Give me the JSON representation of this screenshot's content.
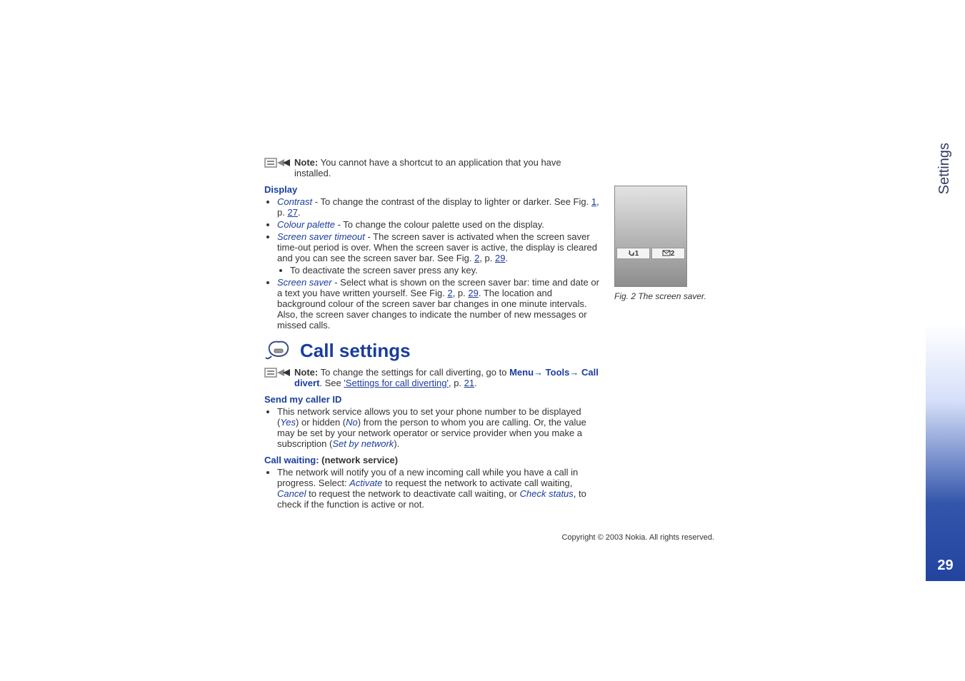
{
  "side_tab": "Settings",
  "page_number": "29",
  "copyright": "Copyright © 2003 Nokia. All rights reserved.",
  "note1": {
    "label": "Note:",
    "text": " You cannot have a shortcut to an application that you have installed."
  },
  "display_heading": "Display",
  "items": {
    "contrast": {
      "link": "Contrast",
      "text1": " - To change the contrast of the display to lighter or darker. See Fig. ",
      "fig": "1",
      "text2": ", p. ",
      "page": "27",
      "text3": "."
    },
    "colour": {
      "link": "Colour palette",
      "text": " - To change the colour palette used on the display."
    },
    "timeout": {
      "link": "Screen saver timeout",
      "text1": " - The screen saver is activated when the screen saver time-out period is over. When the screen saver is active, the display is cleared and you can see the screen saver bar. See Fig. ",
      "fig": "2",
      "text2": ", p. ",
      "page": "29",
      "text3": ".",
      "sub": "To deactivate the screen saver press any key."
    },
    "saver": {
      "link": "Screen saver",
      "text1": " - Select what is shown on the screen saver bar: time and date or a text you have written yourself. See Fig. ",
      "fig": "2",
      "text2": ", p. ",
      "page": "29",
      "text3": ". The location and background colour of the screen saver bar changes in one minute intervals. Also, the screen saver changes to indicate the number of new messages or missed calls."
    }
  },
  "call_settings_heading": "Call settings",
  "note2": {
    "label": "Note:",
    "text1": " To change the settings for call diverting, go to ",
    "menu": "Menu",
    "tools": "Tools",
    "divert": "Call divert",
    "text2": ". See ",
    "ref": "'Settings for call diverting'",
    "text3": ", p. ",
    "page": "21",
    "text4": "."
  },
  "send_heading": "Send my caller ID",
  "send_item": {
    "text1": "This network service allows you to set your phone number to be displayed (",
    "yes": "Yes",
    "text2": ") or hidden (",
    "no": "No",
    "text3": ") from the person to whom you are calling. Or, the value may be set by your network operator or service provider when you make a subscription (",
    "sbn": "Set by network",
    "text4": ")."
  },
  "wait_heading": "Call waiting:",
  "wait_nservice": " (network service)",
  "wait_item": {
    "text1": "The network will notify you of a new incoming call while you have a call in progress. Select: ",
    "activate": "Activate",
    "text2": " to request the network to activate call waiting, ",
    "cancel": "Cancel",
    "text3": " to request the network to deactivate call waiting, or ",
    "check": "Check status",
    "text4": ", to check if the function is active or not."
  },
  "fig2": {
    "caption": "Fig. 2 The screen saver.",
    "cell1_num": "1",
    "cell2_num": "2"
  }
}
